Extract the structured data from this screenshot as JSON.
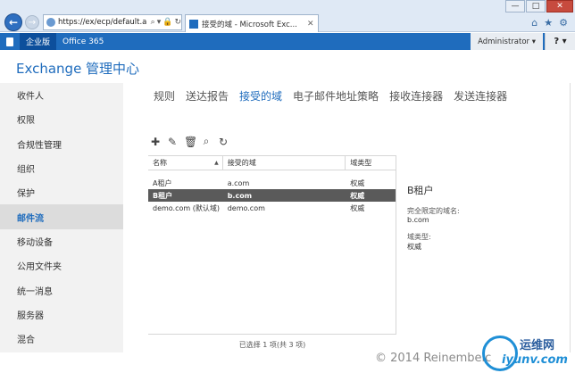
{
  "browser": {
    "address_url": "https://ex/ecp/default.a",
    "tab_label": "接受的域 - Microsoft Exc...",
    "window_controls": [
      "—",
      "□",
      "✕"
    ]
  },
  "topbar": {
    "tabs": [
      "企业版",
      "Office 365"
    ],
    "user": "Administrator ▾",
    "help": "? ▾"
  },
  "app": {
    "title": "Exchange 管理中心"
  },
  "sidebar": {
    "items": [
      "收件人",
      "权限",
      "合规性管理",
      "组织",
      "保护",
      "邮件流",
      "移动设备",
      "公用文件夹",
      "统一消息",
      "服务器",
      "混合"
    ],
    "active_index": 5
  },
  "subtabs": {
    "items": [
      "规则",
      "送达报告",
      "接受的域",
      "电子邮件地址策略",
      "接收连接器",
      "发送连接器"
    ],
    "active_index": 2
  },
  "toolbar": {
    "icons": [
      "add-icon",
      "edit-icon",
      "delete-icon",
      "search-icon",
      "refresh-icon"
    ]
  },
  "list": {
    "headers": [
      "名称",
      "接受的域",
      "域类型"
    ],
    "rows": [
      [
        "A租户",
        "a.com",
        "权威"
      ],
      [
        "B租户",
        "b.com",
        "权威"
      ],
      [
        "demo.com (默认域)",
        "demo.com",
        "权威"
      ]
    ],
    "selected_index": 1,
    "status": "已选择 1 项(共 3 项)"
  },
  "details": {
    "title": "B租户",
    "fqdn_label": "完全限定的域名:",
    "fqdn_value": "b.com",
    "type_label": "域类型:",
    "type_value": "权威"
  },
  "watermark": {
    "copyright": "© 2014 Reinembeic",
    "brand": "运维网",
    "domain": "iyunv.com"
  }
}
